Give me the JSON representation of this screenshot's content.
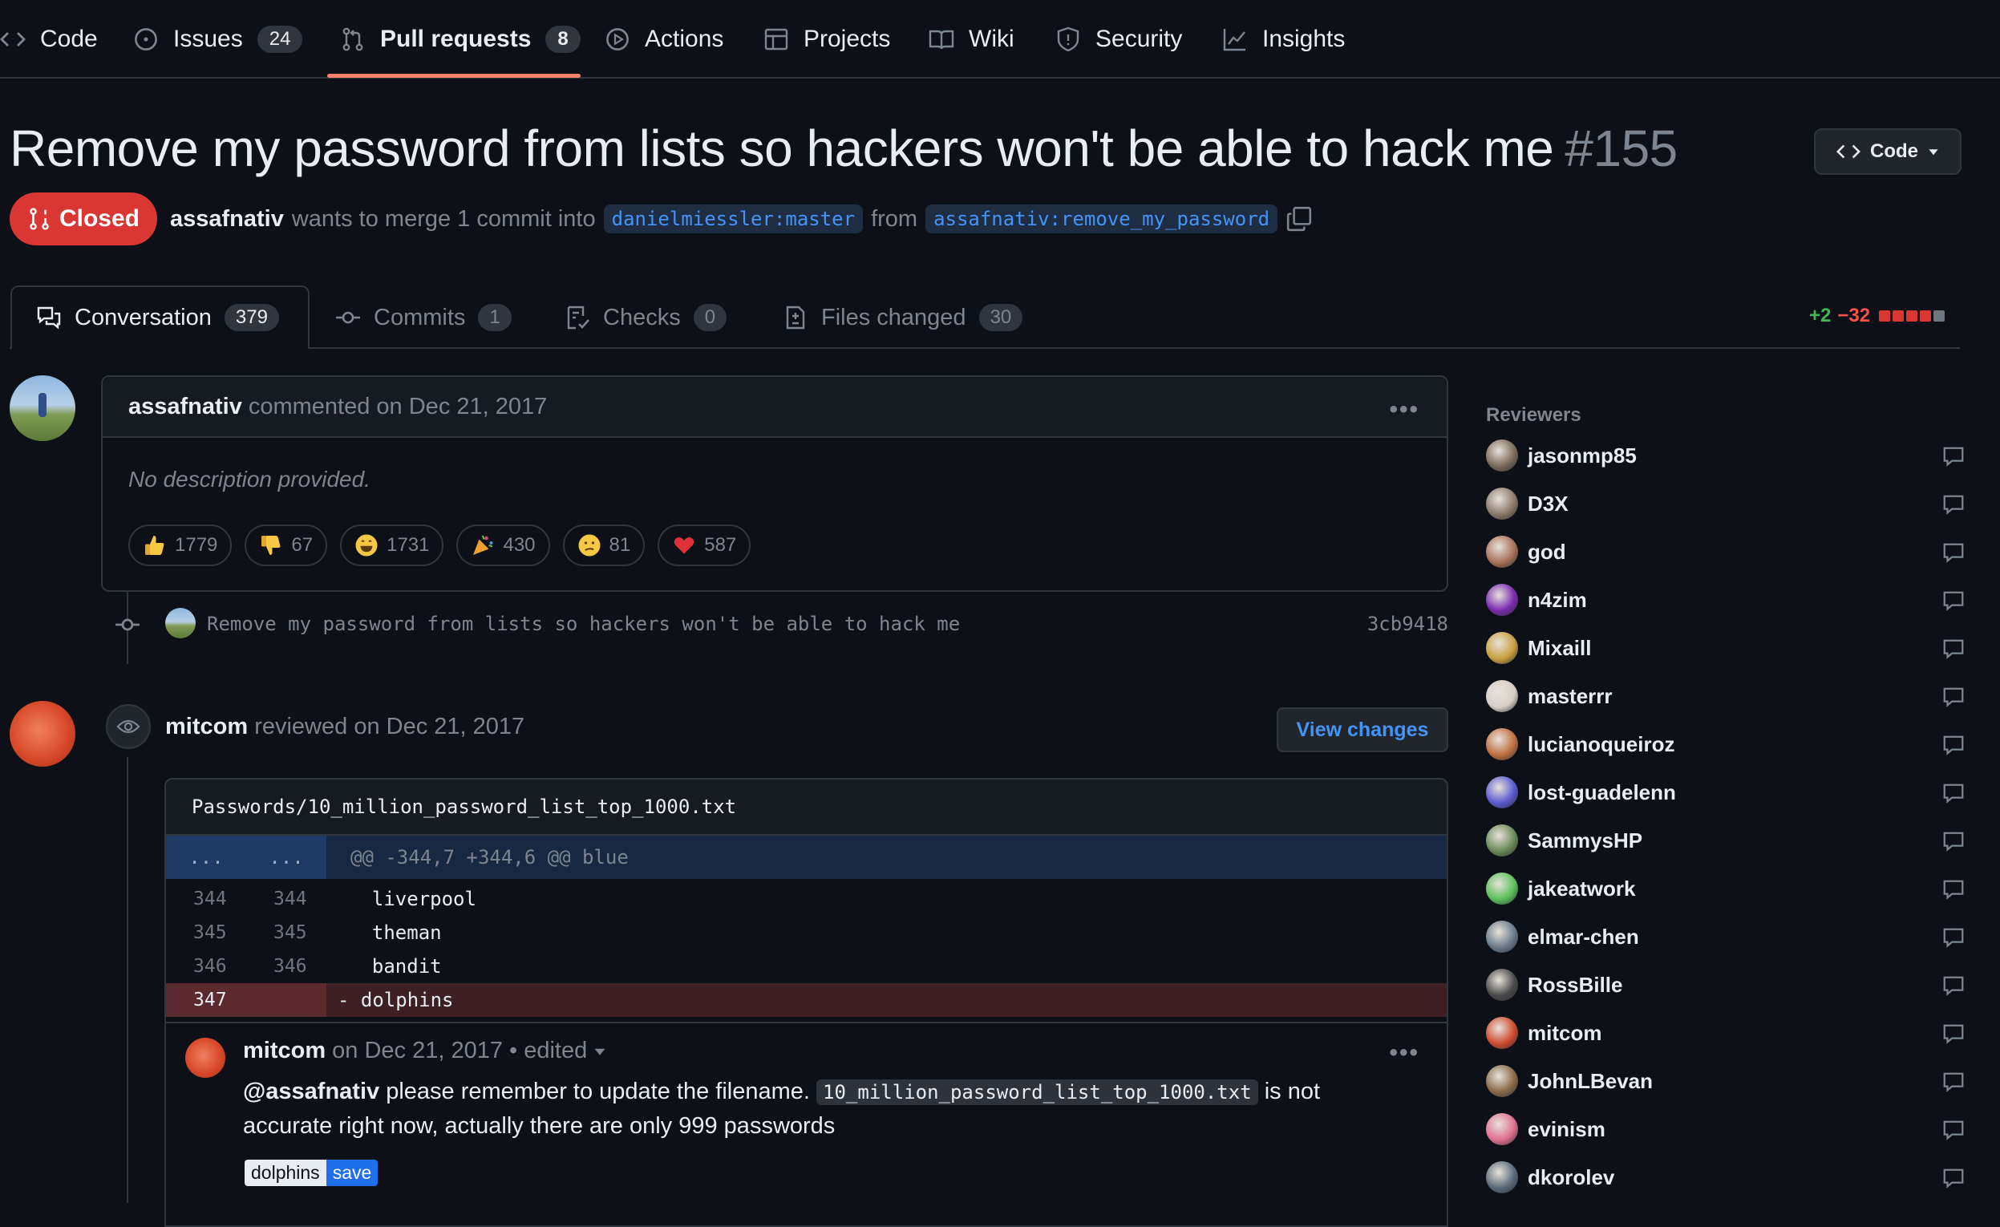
{
  "nav": {
    "tabs": [
      {
        "label": "Code",
        "icon": "code-icon"
      },
      {
        "label": "Issues",
        "count": "24",
        "icon": "issue-icon"
      },
      {
        "label": "Pull requests",
        "count": "8",
        "icon": "pull-request-icon"
      },
      {
        "label": "Actions",
        "icon": "play-icon"
      },
      {
        "label": "Projects",
        "icon": "table-icon"
      },
      {
        "label": "Wiki",
        "icon": "book-icon"
      },
      {
        "label": "Security",
        "icon": "shield-icon"
      },
      {
        "label": "Insights",
        "icon": "graph-icon"
      }
    ],
    "active": "Pull requests"
  },
  "pr": {
    "title": "Remove my password from lists so hackers won't be able to hack me",
    "number": "#155",
    "code_button": "Code",
    "state": "Closed",
    "author": "assafnativ",
    "merge_text": "wants to merge 1 commit into",
    "base_branch": "danielmiessler:master",
    "from_text": "from",
    "head_branch": "assafnativ:remove_my_password"
  },
  "tabs": [
    {
      "label": "Conversation",
      "count": "379",
      "icon": "comment-discussion-icon"
    },
    {
      "label": "Commits",
      "count": "1",
      "icon": "commit-icon"
    },
    {
      "label": "Checks",
      "count": "0",
      "icon": "checklist-icon"
    },
    {
      "label": "Files changed",
      "count": "30",
      "icon": "file-diff-icon"
    }
  ],
  "diffstat": {
    "additions": "+2",
    "deletions": "−32",
    "colors": [
      "#da3633",
      "#da3633",
      "#da3633",
      "#da3633",
      "#6e7681"
    ]
  },
  "comment": {
    "author": "assafnativ",
    "meta": "commented on Dec 21, 2017",
    "body": "No description provided.",
    "reactions": [
      {
        "emoji": "thumbs-up",
        "count": "1779"
      },
      {
        "emoji": "thumbs-down",
        "count": "67"
      },
      {
        "emoji": "laugh",
        "count": "1731"
      },
      {
        "emoji": "hooray",
        "count": "430"
      },
      {
        "emoji": "confused",
        "count": "81"
      },
      {
        "emoji": "heart",
        "count": "587"
      }
    ]
  },
  "commit": {
    "message": "Remove my password from lists so hackers won't be able to hack me",
    "sha": "3cb9418"
  },
  "review": {
    "author": "mitcom",
    "meta": "reviewed on Dec 21, 2017",
    "view_changes": "View changes",
    "file": "Passwords/10_million_password_list_top_1000.txt",
    "hunk": {
      "left": "...",
      "right": "...",
      "header": "@@ -344,7 +344,6 @@ blue"
    },
    "lines": [
      {
        "old": "344",
        "new": "344",
        "code": "  liverpool",
        "type": "context"
      },
      {
        "old": "345",
        "new": "345",
        "code": "  theman",
        "type": "context"
      },
      {
        "old": "346",
        "new": "346",
        "code": "  bandit",
        "type": "context"
      },
      {
        "old": "347",
        "new": "",
        "code": "- dolphins",
        "type": "deletion"
      }
    ],
    "reply": {
      "author": "mitcom",
      "meta": "on Dec 21, 2017 • edited",
      "mention": "@assafnativ",
      "text1": "please remember to update the filename.",
      "code": "10_million_password_list_top_1000.txt",
      "text2": "is not accurate right now, actually there are only 999 passwords",
      "label1": "dolphins",
      "label2": "save"
    }
  },
  "sidebar": {
    "reviewers_heading": "Reviewers",
    "reviewers": [
      {
        "name": "jasonmp85",
        "color": "#7a6a5a"
      },
      {
        "name": "D3X",
        "color": "#8a7a6a"
      },
      {
        "name": "god",
        "color": "#a8705a"
      },
      {
        "name": "n4zim",
        "color": "#7a2ab0"
      },
      {
        "name": "Mixaill",
        "color": "#c8a040"
      },
      {
        "name": "masterrr",
        "color": "#d8d0c8"
      },
      {
        "name": "lucianoqueiroz",
        "color": "#c07040"
      },
      {
        "name": "lost-guadelenn",
        "color": "#5a5ad0"
      },
      {
        "name": "SammysHP",
        "color": "#6a8a5a"
      },
      {
        "name": "jakeatwork",
        "color": "#5ac05a"
      },
      {
        "name": "elmar-chen",
        "color": "#6a7a8a"
      },
      {
        "name": "RossBille",
        "color": "#4a4a4a"
      },
      {
        "name": "mitcom",
        "color": "#d04a30"
      },
      {
        "name": "JohnLBevan",
        "color": "#8a6a4a"
      },
      {
        "name": "evinism",
        "color": "#e07090"
      },
      {
        "name": "dkorolev",
        "color": "#5a6a7a"
      }
    ]
  }
}
